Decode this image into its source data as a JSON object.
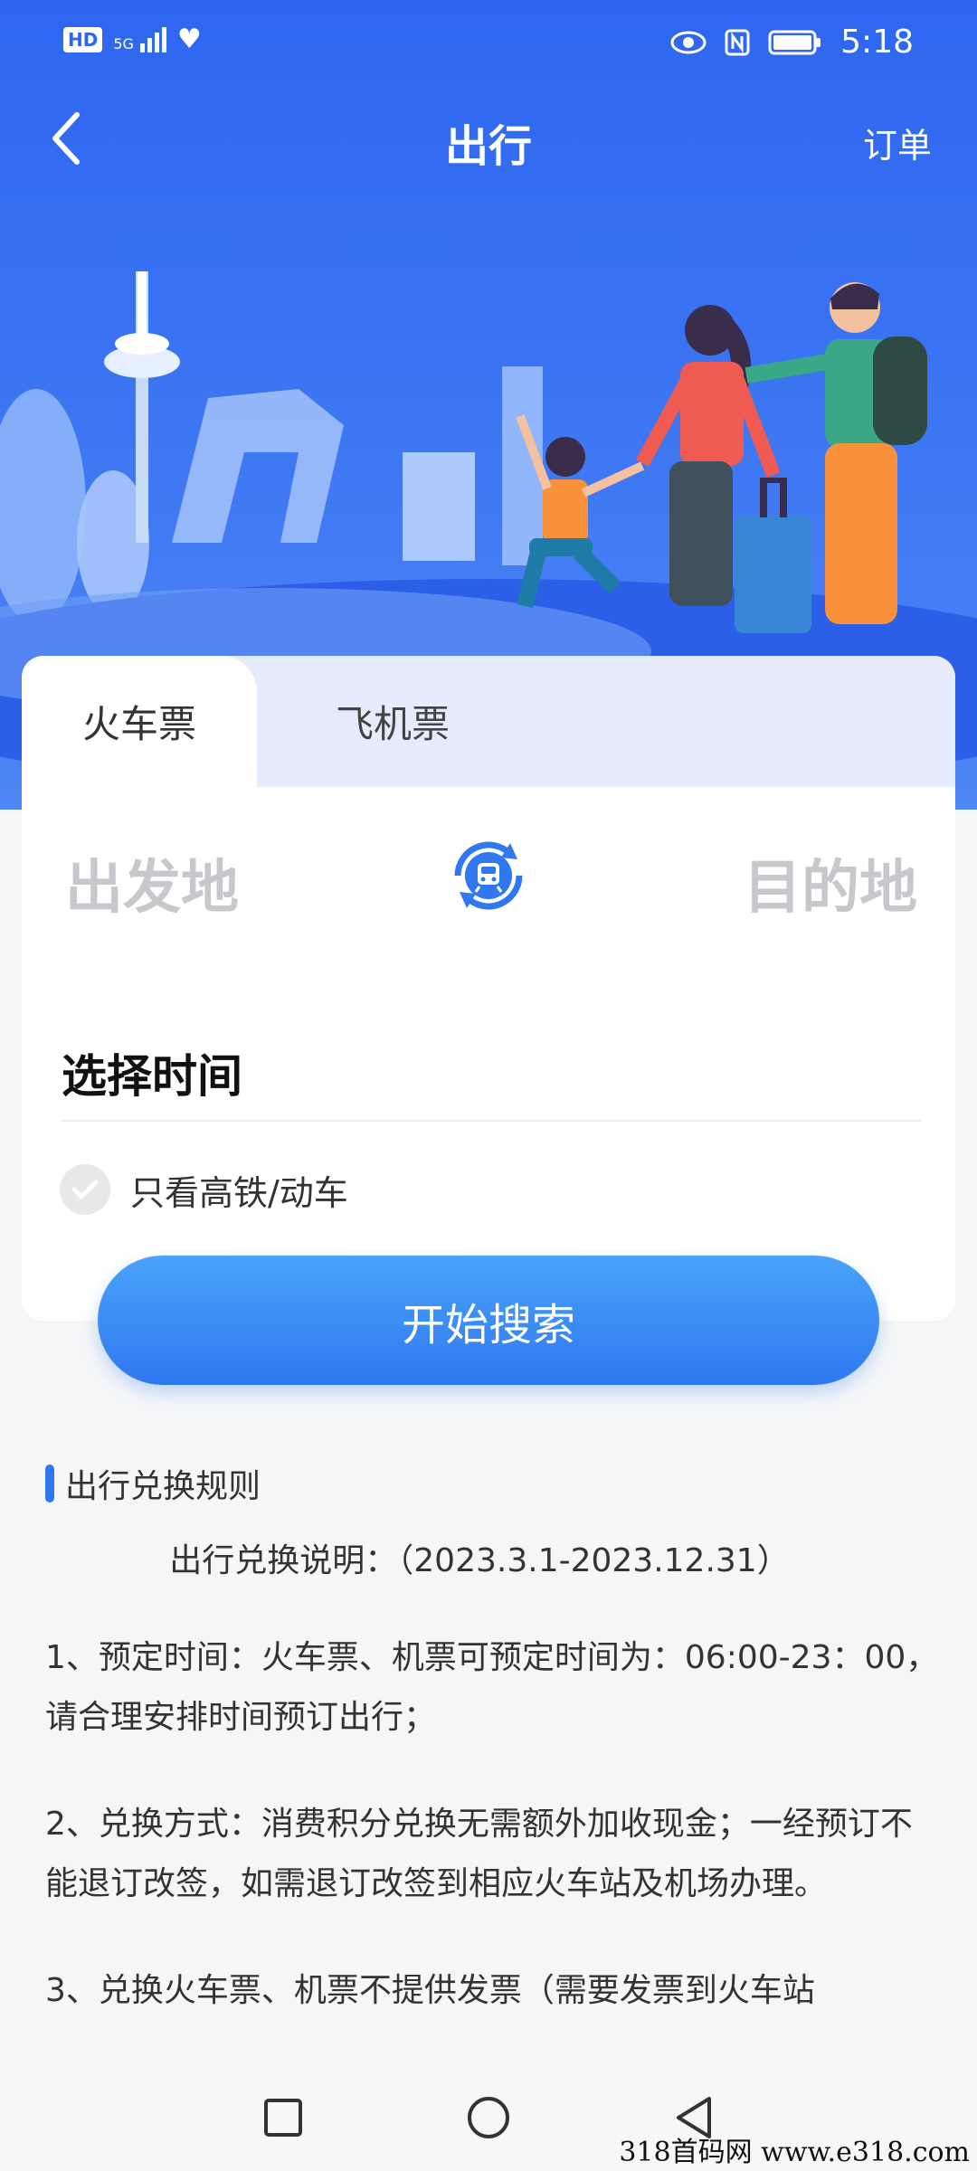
{
  "status_bar": {
    "hd_label": "HD",
    "net_label": "5G",
    "time": "5:18",
    "icons": [
      "signal-icon",
      "wifi-icon",
      "eye-icon",
      "nfc-icon",
      "battery-icon"
    ]
  },
  "header": {
    "title": "出行",
    "order_label": "订单"
  },
  "tabs": [
    {
      "label": "火车票",
      "active": true
    },
    {
      "label": "飞机票",
      "active": false
    }
  ],
  "route": {
    "from_placeholder": "出发地",
    "to_placeholder": "目的地",
    "swap_icon": "train-swap-icon"
  },
  "date": {
    "label": "选择时间"
  },
  "filter": {
    "label": "只看高铁/动车",
    "checked": false
  },
  "search_button": "开始搜索",
  "rules": {
    "title": "出行兑换规则",
    "subtitle": "出行兑换说明：（2023.3.1-2023.12.31）",
    "items": [
      "1、预定时间：火车票、机票可预定时间为：06:00-23：00，请合理安排时间预订出行；",
      "2、兑换方式：消费积分兑换无需额外加收现金；一经预订不能退订改签，如需退订改签到相应火车站及机场办理。",
      "3、兑换火车票、机票不提供发票（需要发票到火车站"
    ]
  },
  "colors": {
    "primary": "#2e66f0",
    "button_gradient_top": "#4aa3fb",
    "button_gradient_bottom": "#2f78ef",
    "placeholder": "#c8c8cc"
  },
  "watermark": "318首码网  www.e318.com"
}
